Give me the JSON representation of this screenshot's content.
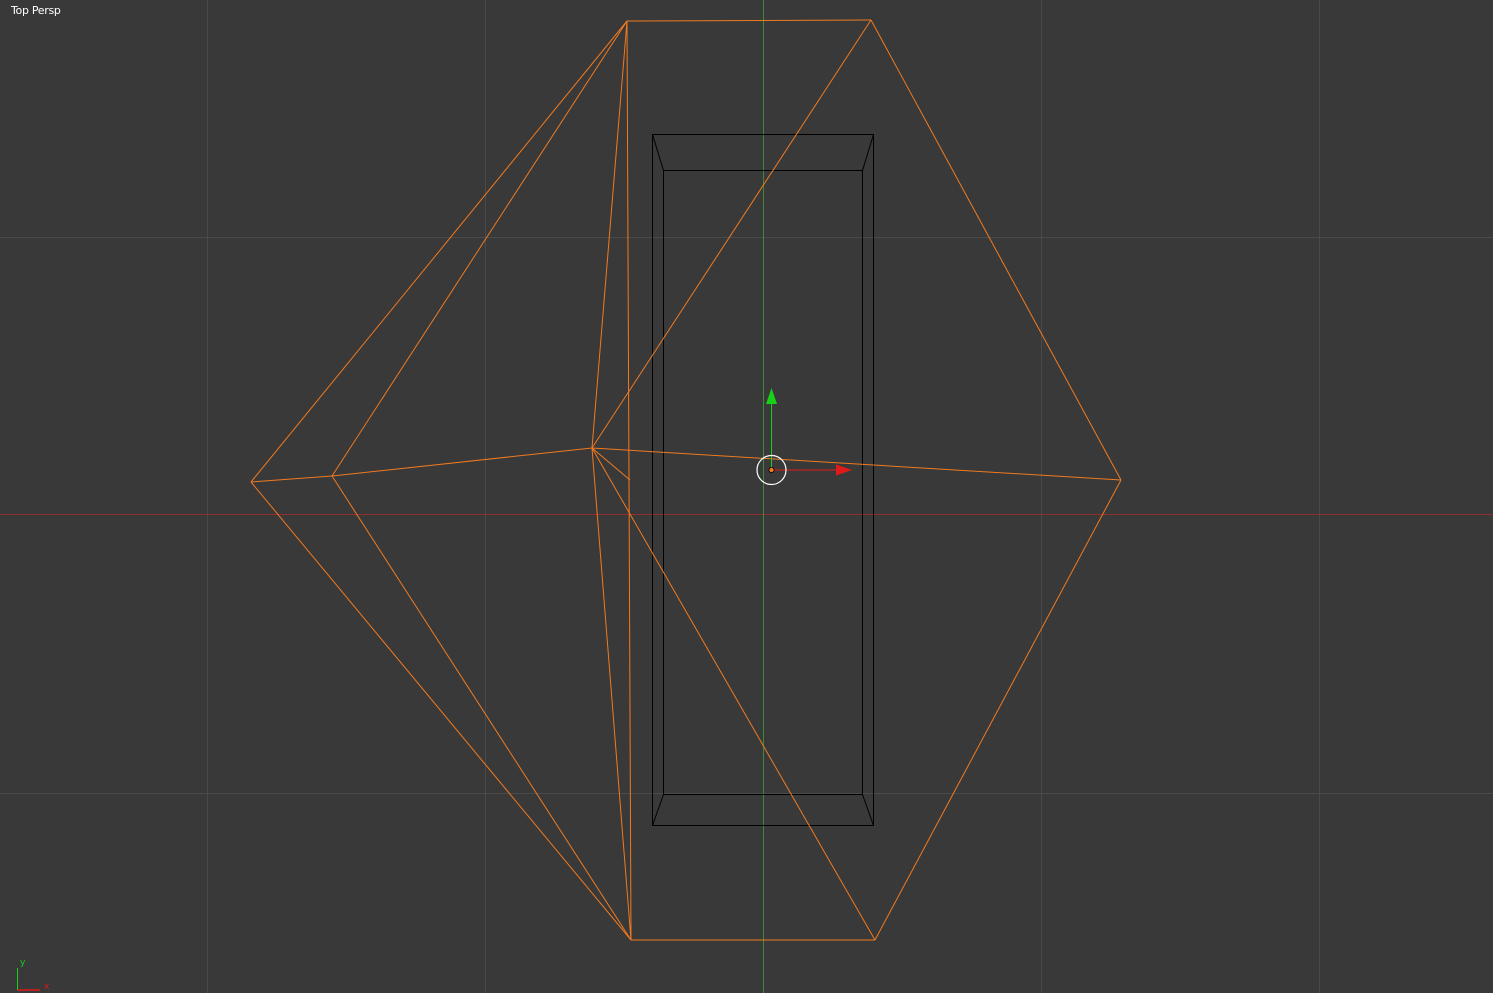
{
  "viewport": {
    "view_name": "Top Persp"
  },
  "axis_widget": {
    "y_label": "y",
    "x_label": "x"
  },
  "colors": {
    "background": "#393939",
    "grid": "#4a4a4a",
    "x_axis": "#8f2e2e",
    "y_axis": "#3c8a3c",
    "selected_wire": "#f07a20",
    "wire": "#000000",
    "gizmo_x": "#e01919",
    "gizmo_y": "#19d019",
    "gizmo_ring": "#ffffff"
  }
}
